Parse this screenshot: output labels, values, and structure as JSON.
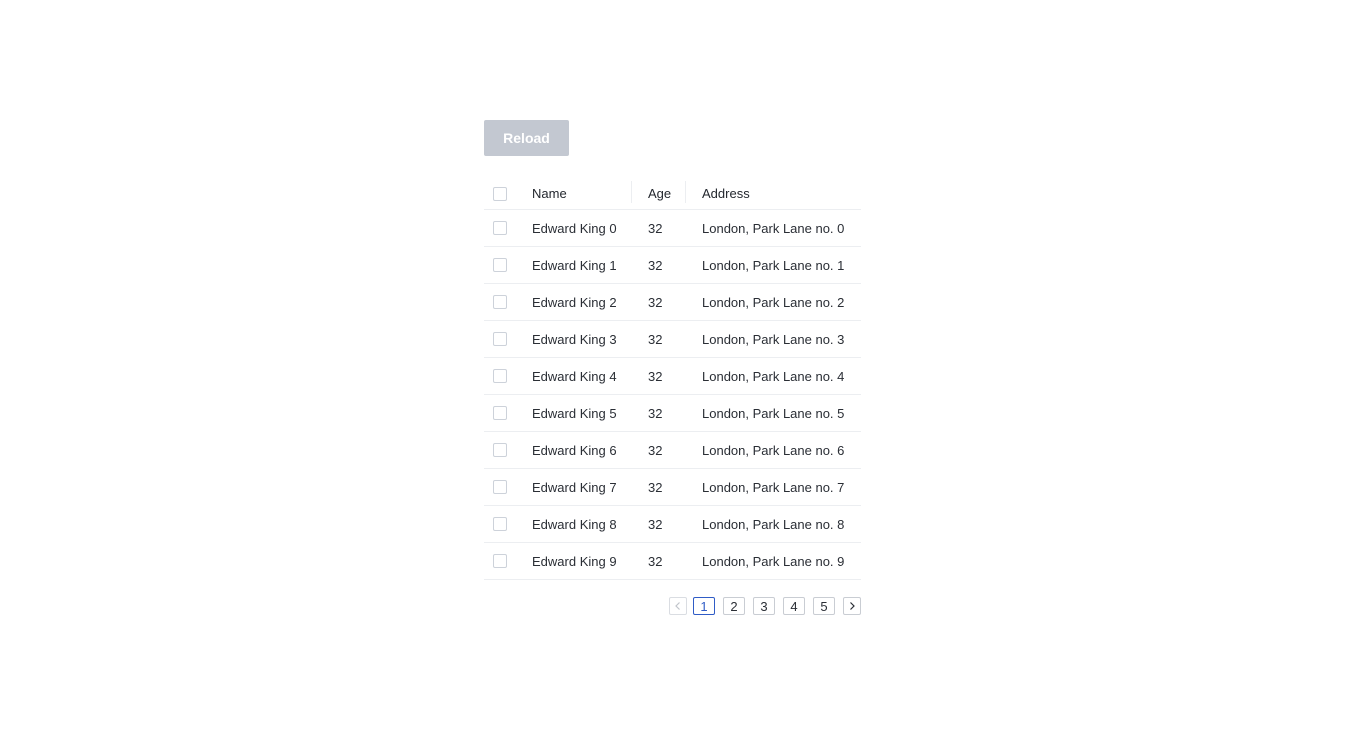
{
  "toolbar": {
    "reload_label": "Reload"
  },
  "table": {
    "columns": [
      "Name",
      "Age",
      "Address"
    ],
    "rows": [
      {
        "name": "Edward King 0",
        "age": "32",
        "address": "London, Park Lane no. 0"
      },
      {
        "name": "Edward King 1",
        "age": "32",
        "address": "London, Park Lane no. 1"
      },
      {
        "name": "Edward King 2",
        "age": "32",
        "address": "London, Park Lane no. 2"
      },
      {
        "name": "Edward King 3",
        "age": "32",
        "address": "London, Park Lane no. 3"
      },
      {
        "name": "Edward King 4",
        "age": "32",
        "address": "London, Park Lane no. 4"
      },
      {
        "name": "Edward King 5",
        "age": "32",
        "address": "London, Park Lane no. 5"
      },
      {
        "name": "Edward King 6",
        "age": "32",
        "address": "London, Park Lane no. 6"
      },
      {
        "name": "Edward King 7",
        "age": "32",
        "address": "London, Park Lane no. 7"
      },
      {
        "name": "Edward King 8",
        "age": "32",
        "address": "London, Park Lane no. 8"
      },
      {
        "name": "Edward King 9",
        "age": "32",
        "address": "London, Park Lane no. 9"
      }
    ]
  },
  "pagination": {
    "pages": [
      "1",
      "2",
      "3",
      "4",
      "5"
    ],
    "current": "1",
    "prev_icon": "chevron-left-icon",
    "next_icon": "chevron-right-icon"
  },
  "colors": {
    "reload_disabled_bg": "#c3c8d1",
    "active_page": "#2f5cc6",
    "row_border": "#eceef1"
  }
}
